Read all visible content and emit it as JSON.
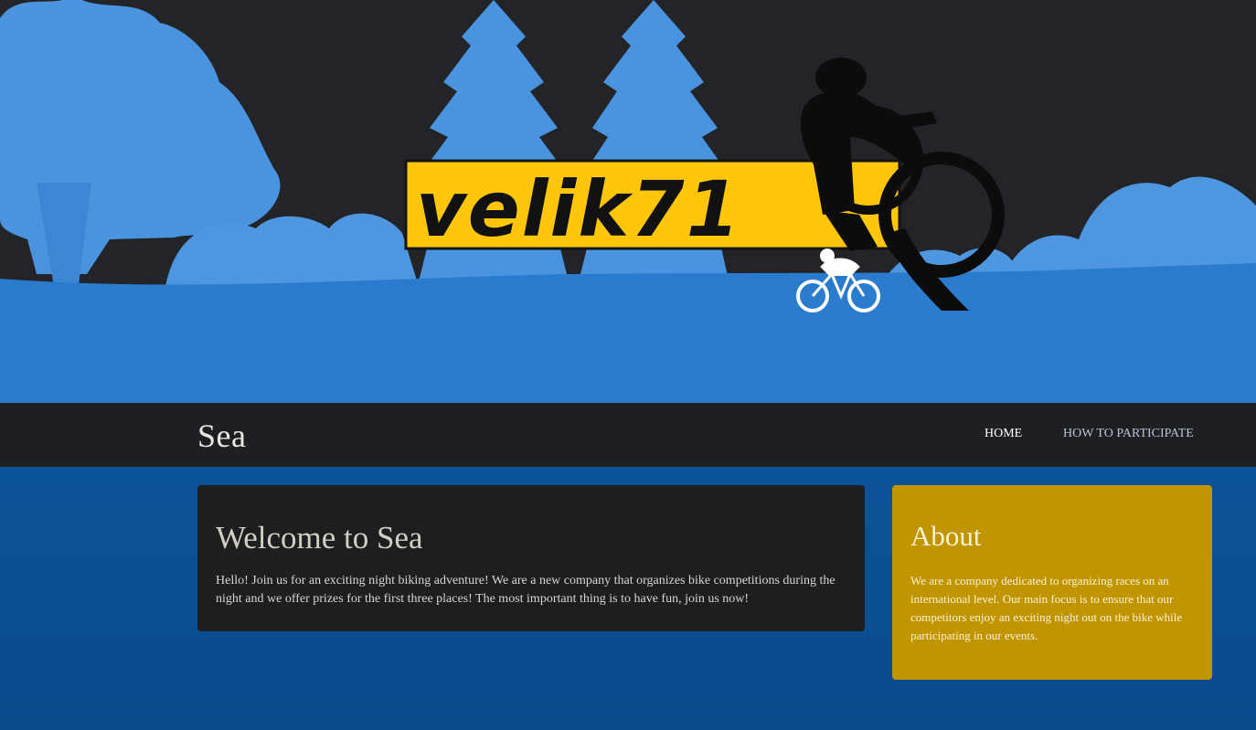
{
  "hero": {
    "logo_text": "velik71",
    "colors": {
      "sky": "#232427",
      "trees_light": "#4a94df",
      "trees_mid": "#3a86d6",
      "ground": "#2a7bcd",
      "logo_yellow": "#ffc60a",
      "logo_text": "#111111",
      "rider": "#0c0c0c"
    }
  },
  "nav": {
    "brand": "Sea",
    "items": [
      {
        "label": "HOME",
        "active": true
      },
      {
        "label": "HOW TO PARTICIPATE",
        "active": false
      }
    ]
  },
  "welcome": {
    "title": "Welcome to Sea",
    "text": "Hello! Join us for an exciting night biking adventure! We are a new company that organizes bike competitions during the night and we offer prizes for the first three places! The most important thing is to have fun, join us now!"
  },
  "about": {
    "title": "About",
    "text": "We are a company dedicated to organizing races on an international level. Our main focus is to ensure that our competitors enjoy an exciting night out on the bike while participating in our events."
  }
}
